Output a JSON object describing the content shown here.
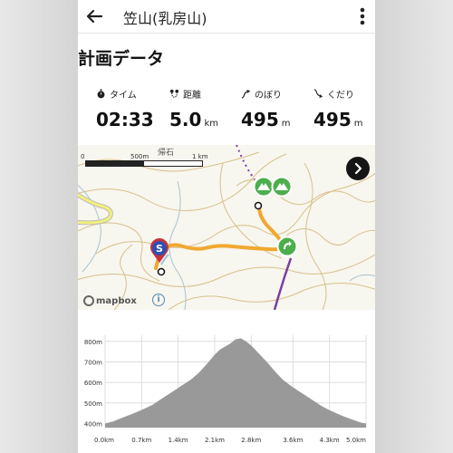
{
  "appbar": {
    "title": "笠山(乳房山)"
  },
  "plan": {
    "heading": "計画データ",
    "stats": [
      {
        "label": "タイム",
        "value": "02:33",
        "unit": "",
        "icon": "stopwatch-icon"
      },
      {
        "label": "距離",
        "value": "5.0",
        "unit": "km",
        "icon": "route-distance-icon"
      },
      {
        "label": "のぼり",
        "value": "495",
        "unit": "m",
        "icon": "ascent-arrow-icon"
      },
      {
        "label": "くだり",
        "value": "495",
        "unit": "m",
        "icon": "descent-arrow-icon"
      }
    ]
  },
  "map": {
    "place_label": "帰石",
    "scale_labels": [
      "0",
      "500m",
      "1 km"
    ],
    "start_marker": "S",
    "attribution": "mapbox",
    "route_color": "#f0a830",
    "trail_color": "#7b3fa0"
  },
  "chart_data": {
    "type": "area",
    "x_label_ticks": [
      "0.0km",
      "0.7km",
      "1.4km",
      "2.1km",
      "2.8km",
      "3.6km",
      "4.3km",
      "5.0km"
    ],
    "y_label_ticks": [
      "800m",
      "700m",
      "600m",
      "500m",
      "400m"
    ],
    "xlim": [
      0,
      5.0
    ],
    "ylim": [
      380,
      830
    ],
    "x": [
      0.0,
      0.15,
      0.3,
      0.45,
      0.6,
      0.75,
      0.9,
      1.05,
      1.2,
      1.35,
      1.5,
      1.65,
      1.8,
      1.95,
      2.1,
      2.2,
      2.3,
      2.4,
      2.5,
      2.6,
      2.7,
      2.8,
      2.95,
      3.1,
      3.25,
      3.4,
      3.55,
      3.7,
      3.85,
      4.0,
      4.15,
      4.3,
      4.45,
      4.6,
      4.75,
      4.9,
      5.0
    ],
    "y": [
      400,
      410,
      425,
      440,
      455,
      472,
      490,
      515,
      540,
      565,
      590,
      615,
      648,
      690,
      735,
      760,
      775,
      790,
      810,
      815,
      800,
      780,
      740,
      700,
      655,
      615,
      585,
      560,
      535,
      510,
      485,
      465,
      448,
      432,
      418,
      405,
      400
    ],
    "fill_color": "#999999",
    "grid": true
  }
}
